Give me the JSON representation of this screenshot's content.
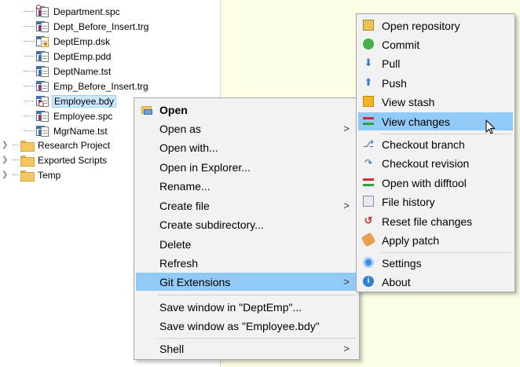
{
  "tree": {
    "files": [
      {
        "name": "Department.spc",
        "icon": "package-spec-icon",
        "selected": false
      },
      {
        "name": "Dept_Before_Insert.trg",
        "icon": "trigger-icon",
        "selected": false
      },
      {
        "name": "DeptEmp.dsk",
        "icon": "desktop-file-icon",
        "selected": false
      },
      {
        "name": "DeptEmp.pdd",
        "icon": "pdd-file-icon",
        "selected": false
      },
      {
        "name": "DeptName.tst",
        "icon": "test-script-icon",
        "selected": false
      },
      {
        "name": "Emp_Before_Insert.trg",
        "icon": "trigger-icon",
        "selected": false
      },
      {
        "name": "Employee.bdy",
        "icon": "package-body-icon",
        "selected": true
      },
      {
        "name": "Employee.spc",
        "icon": "package-spec-icon",
        "selected": false
      },
      {
        "name": "MgrName.tst",
        "icon": "test-script-icon",
        "selected": false
      }
    ],
    "folders": [
      {
        "name": "Research Project"
      },
      {
        "name": "Exported Scripts"
      },
      {
        "name": "Temp"
      }
    ]
  },
  "context_menu": {
    "items": [
      {
        "label": "Open",
        "bold": true,
        "submenu": false,
        "icon": "open-folder-icon"
      },
      {
        "label": "Open as",
        "submenu": true
      },
      {
        "label": "Open with...",
        "submenu": false
      },
      {
        "label": "Open in Explorer...",
        "submenu": false
      },
      {
        "label": "Rename...",
        "submenu": false
      },
      {
        "label": "Create file",
        "submenu": true
      },
      {
        "label": "Create subdirectory...",
        "submenu": false
      },
      {
        "label": "Delete",
        "submenu": false
      },
      {
        "label": "Refresh",
        "submenu": false
      },
      {
        "label": "Git Extensions",
        "submenu": true,
        "highlighted": true
      },
      {
        "label": "Save window in \"DeptEmp\"...",
        "submenu": false
      },
      {
        "label": "Save window as \"Employee.bdy\"",
        "submenu": false
      },
      {
        "label": "Shell",
        "submenu": true
      }
    ],
    "submenu_glyph": ">"
  },
  "git_menu": {
    "items": [
      {
        "label": "Open repository",
        "icon": "open-repository-icon"
      },
      {
        "label": "Commit",
        "icon": "commit-icon"
      },
      {
        "label": "Pull",
        "icon": "pull-arrow-icon"
      },
      {
        "label": "Push",
        "icon": "push-arrow-icon"
      },
      {
        "label": "View stash",
        "icon": "stash-icon"
      },
      {
        "label": "View changes",
        "icon": "view-changes-icon",
        "highlighted": true
      },
      {
        "label": "Checkout branch",
        "icon": "checkout-branch-icon"
      },
      {
        "label": "Checkout revision",
        "icon": "checkout-revision-icon"
      },
      {
        "label": "Open with difftool",
        "icon": "difftool-icon"
      },
      {
        "label": "File history",
        "icon": "file-history-icon"
      },
      {
        "label": "Reset file changes",
        "icon": "reset-icon"
      },
      {
        "label": "Apply patch",
        "icon": "apply-patch-icon"
      },
      {
        "label": "Settings",
        "icon": "settings-icon"
      },
      {
        "label": "About",
        "icon": "about-icon"
      }
    ]
  },
  "colors": {
    "editor_background": "#fdfde6",
    "menu_background": "#f2f2f2",
    "menu_highlight": "#91c9f7",
    "tree_selection": "#cce8ff"
  }
}
